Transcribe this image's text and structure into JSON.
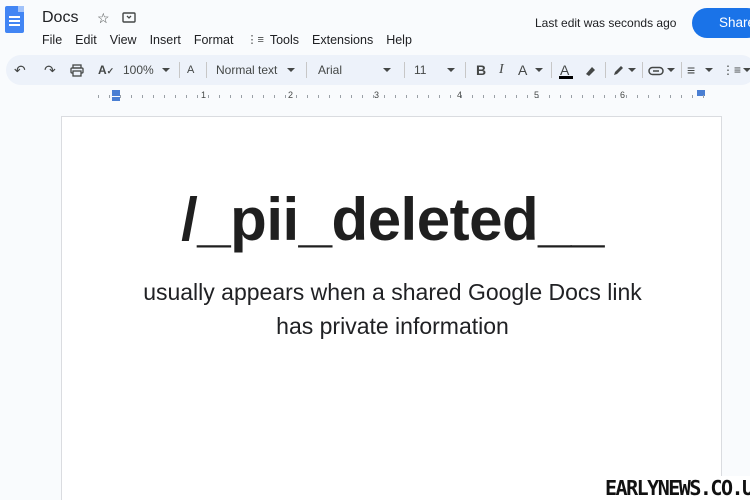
{
  "header": {
    "app_title": "Docs",
    "last_edit": "Last edit was seconds ago",
    "share_label": "Share"
  },
  "menu": {
    "items": [
      "File",
      "Edit",
      "View",
      "Insert",
      "Format",
      "Tools",
      "Extensions",
      "Help"
    ]
  },
  "toolbar": {
    "zoom": "100%",
    "style": "Normal text",
    "font": "Arial",
    "font_size": "11",
    "bold": "B",
    "italic": "I",
    "text_color": "A",
    "spellcheck": "A"
  },
  "ruler": {
    "numbers": [
      "1",
      "2",
      "3",
      "4",
      "5",
      "6"
    ]
  },
  "document": {
    "headline": "/_pii_deleted__",
    "line1": "usually appears when a shared Google Docs link",
    "line2": "has private information"
  },
  "watermark": "EARLYNEWS.CO.UK",
  "colors": {
    "accent": "#1a73e8",
    "toolbar_bg": "#edf2fa",
    "logo_blue": "#4285f4"
  }
}
